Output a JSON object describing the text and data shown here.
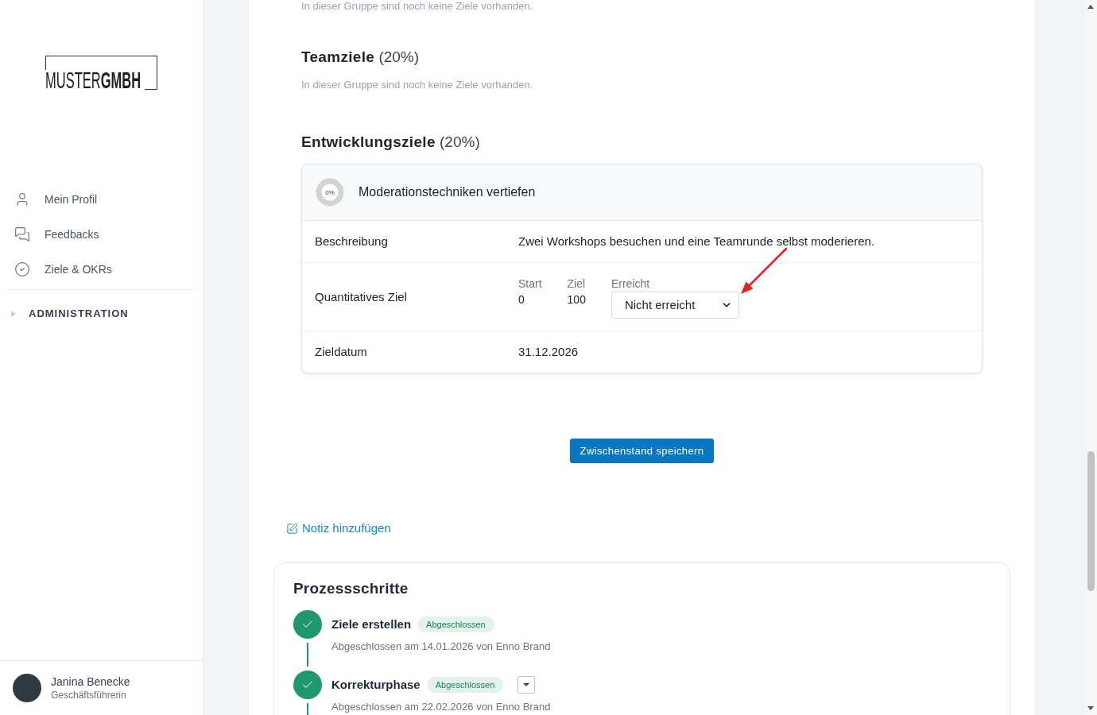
{
  "sidebar": {
    "logo": "MUSTER**GMBH**",
    "nav_items": [
      {
        "label": "Mein Profil"
      },
      {
        "label": "Feedbacks"
      },
      {
        "label": "Ziele & OKRs"
      }
    ],
    "section": {
      "label": "ADMINISTRATION",
      "expanded": false
    },
    "user": {
      "name": "Janina Benecke",
      "role": "Geschäftsführerin"
    }
  },
  "main": {
    "previous_group_note": "In dieser Gruppe sind noch keine Ziele vorhanden.",
    "goal_groups": [
      {
        "title": "Teamziele",
        "weight": "(20%)",
        "empty_note": "In dieser Gruppe sind noch keine Ziele vorhanden."
      },
      {
        "title": "Entwicklungsziele",
        "weight": "(20%)",
        "goals": [
          {
            "title": "Moderationstechniken vertiefen",
            "progress_label": "0%",
            "level": 0,
            "rows": [
              {
                "kind": "text",
                "label": "Beschreibung",
                "value": "Zwei Workshops besuchen und eine Teamrunde selbst moderieren."
              },
              {
                "kind": "quantitative",
                "label": "Quantitatives Ziel",
                "fields": [
                  {
                    "label": "Start",
                    "value": "0"
                  },
                  {
                    "label": "Ziel",
                    "value": "100"
                  }
                ],
                "select": {
                  "label": "Erreicht",
                  "value": "Nicht erreicht"
                }
              },
              {
                "kind": "text",
                "label": "Zieldatum",
                "value": "31.12.2026"
              }
            ]
          }
        ]
      }
    ],
    "save_button": "Zwischenstand speichern",
    "add_note_link": "Notiz hinzufügen",
    "process": {
      "title": "Prozessschritte",
      "steps": [
        {
          "title": "Ziele erstellen",
          "status": "Abgeschlossen",
          "done": true,
          "has_menu": false,
          "note": "Abgeschlossen am 14.01.2026 von Enno Brand"
        },
        {
          "title": "Korrekturphase",
          "status": "Abgeschlossen",
          "done": true,
          "has_menu": true,
          "note": "Abgeschlossen am 22.02.2026 von Enno Brand"
        }
      ]
    }
  }
}
